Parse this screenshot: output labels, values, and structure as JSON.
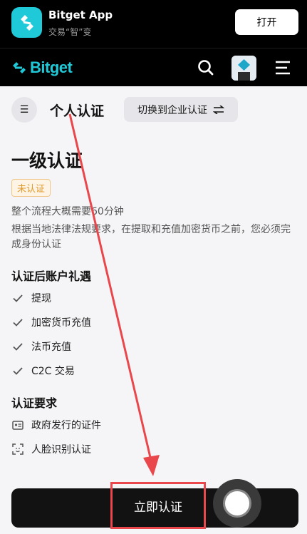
{
  "banner": {
    "app_name": "Bitget App",
    "tagline": "交易“智”变",
    "open_label": "打开"
  },
  "nav": {
    "logo_text": "Bitget",
    "brand_color": "#1fc9d8"
  },
  "header": {
    "title": "个人认证",
    "switch_label": "切换到企业认证"
  },
  "level": {
    "title": "一级认证",
    "status_badge": "未认证",
    "time_estimate": "整个流程大概需要60分钟",
    "description": "根据当地法律法规要求，在提取和充值加密货币之前，您必须完成身份认证"
  },
  "benefits": {
    "title": "认证后账户礼遇",
    "items": [
      "提现",
      "加密货币充值",
      "法币充值",
      "C2C 交易"
    ]
  },
  "requirements": {
    "title": "认证要求",
    "items": [
      "政府发行的证件",
      "人脸识别认证"
    ]
  },
  "cta": {
    "label": "立即认证"
  },
  "annotation": {
    "color": "#e9474c"
  }
}
